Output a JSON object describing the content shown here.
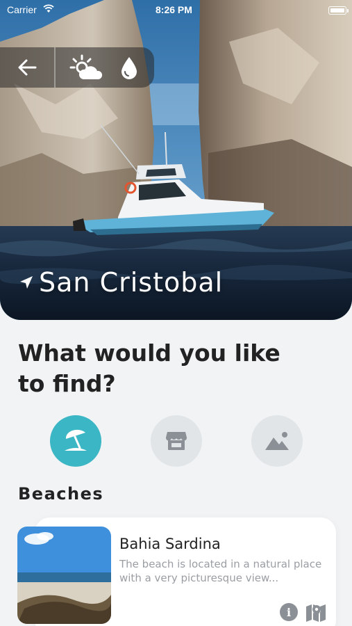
{
  "status_bar": {
    "carrier": "Carrier",
    "time": "8:26 PM"
  },
  "header": {
    "back_icon": "arrow-left-icon",
    "weather_icon": "partly-sunny-icon",
    "humidity_icon": "water-drop-icon"
  },
  "location": {
    "icon": "navigation-arrow-icon",
    "name": "San Cristobal"
  },
  "main": {
    "question": "What would you like to find?",
    "categories": [
      {
        "icon": "beach-umbrella-icon",
        "active": true
      },
      {
        "icon": "store-icon",
        "active": false
      },
      {
        "icon": "landscape-icon",
        "active": false
      }
    ],
    "section_title": "Beaches",
    "places": [
      {
        "title": "Bahia Sardina",
        "description": "The beach is located in a natural place with a very picturesque view...",
        "info_icon": "info-icon",
        "map_icon": "map-icon"
      }
    ]
  },
  "colors": {
    "accent": "#3bb6c4",
    "inactive": "#e2e5e8",
    "icon_gray": "#8b9096"
  }
}
